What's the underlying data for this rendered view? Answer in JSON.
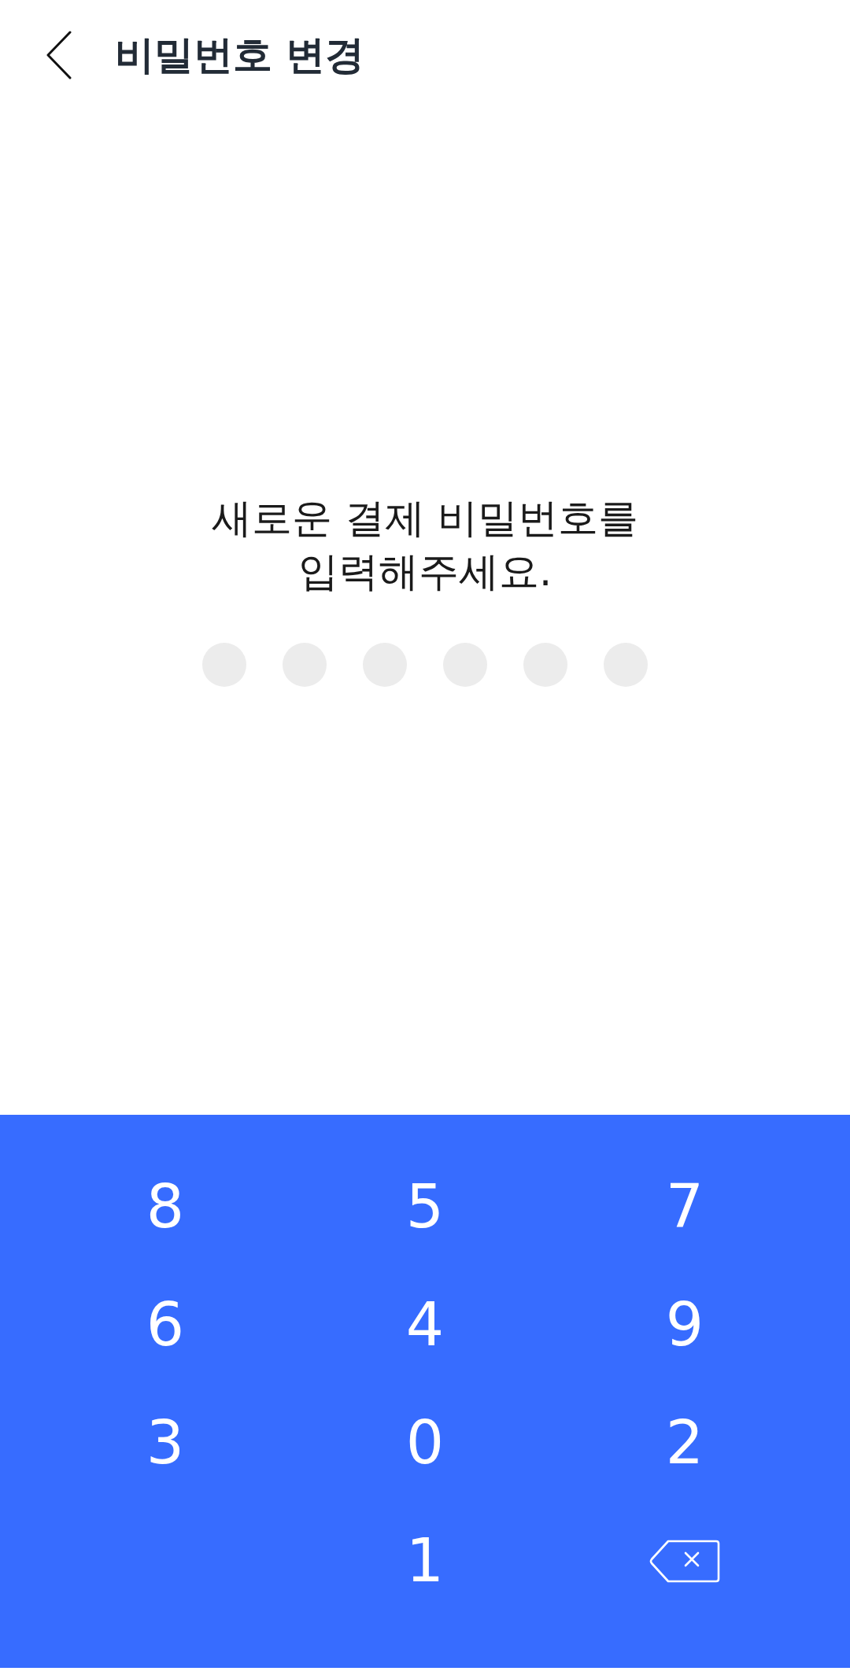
{
  "header": {
    "title": "비밀번호 변경"
  },
  "prompt": "새로운 결제 비밀번호를\n입력해주세요.",
  "pin_dots": [
    {
      "filled": false
    },
    {
      "filled": false
    },
    {
      "filled": false
    },
    {
      "filled": false
    },
    {
      "filled": false
    },
    {
      "filled": false
    }
  ],
  "keypad": {
    "keys": [
      {
        "kind": "digit",
        "label": "8"
      },
      {
        "kind": "digit",
        "label": "5"
      },
      {
        "kind": "digit",
        "label": "7"
      },
      {
        "kind": "digit",
        "label": "6"
      },
      {
        "kind": "digit",
        "label": "4"
      },
      {
        "kind": "digit",
        "label": "9"
      },
      {
        "kind": "digit",
        "label": "3"
      },
      {
        "kind": "digit",
        "label": "0"
      },
      {
        "kind": "digit",
        "label": "2"
      },
      {
        "kind": "blank"
      },
      {
        "kind": "digit",
        "label": "1"
      },
      {
        "kind": "backspace"
      }
    ]
  }
}
